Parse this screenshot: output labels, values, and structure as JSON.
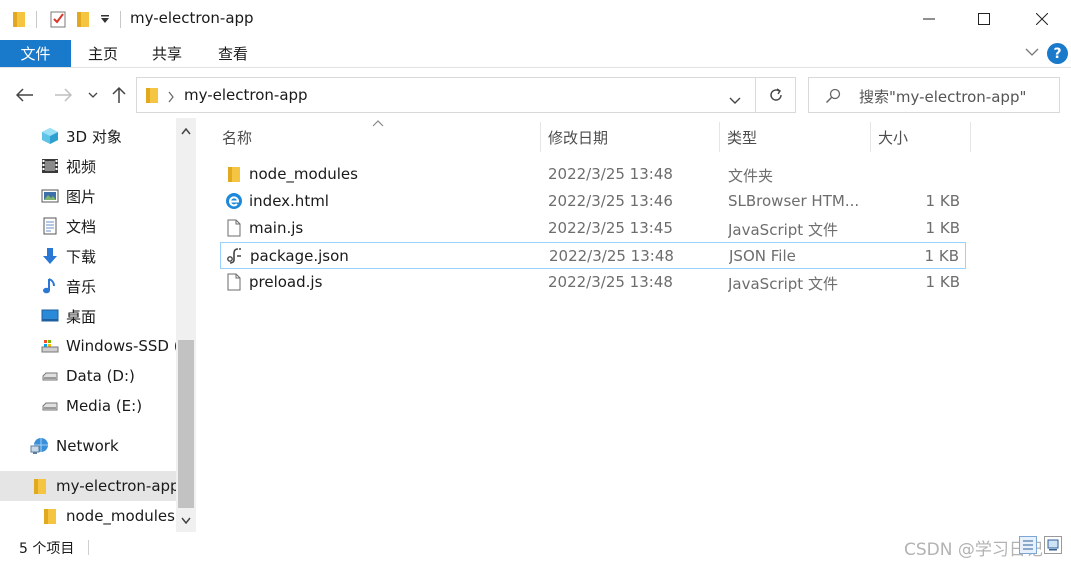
{
  "window": {
    "title": "my-electron-app",
    "minimize_glyph": "—",
    "maximize_glyph": "☐",
    "close_glyph": "✕"
  },
  "ribbon": {
    "tabs": [
      {
        "label": "文件",
        "active": true
      },
      {
        "label": "主页"
      },
      {
        "label": "共享"
      },
      {
        "label": "查看"
      }
    ],
    "help_glyph": "?"
  },
  "address": {
    "path_segment": "my-electron-app",
    "search_placeholder": "搜索\"my-electron-app\""
  },
  "sidebar": {
    "items": [
      {
        "label": "3D 对象",
        "icon": "3d-objects-icon"
      },
      {
        "label": "视频",
        "icon": "video-icon"
      },
      {
        "label": "图片",
        "icon": "pictures-icon"
      },
      {
        "label": "文档",
        "icon": "documents-icon"
      },
      {
        "label": "下载",
        "icon": "download-icon"
      },
      {
        "label": "音乐",
        "icon": "music-icon"
      },
      {
        "label": "桌面",
        "icon": "desktop-icon"
      },
      {
        "label": "Windows-SSD (",
        "icon": "drive-c-icon"
      },
      {
        "label": "Data (D:)",
        "icon": "drive-icon"
      },
      {
        "label": "Media (E:)",
        "icon": "drive-icon"
      },
      {
        "label": "Network",
        "icon": "network-icon"
      },
      {
        "label": "my-electron-app",
        "icon": "folder-icon",
        "selected": true
      },
      {
        "label": "node_modules",
        "icon": "folder-icon"
      }
    ]
  },
  "columns": {
    "name": "名称",
    "date": "修改日期",
    "type": "类型",
    "size": "大小"
  },
  "files": [
    {
      "name": "node_modules",
      "date": "2022/3/25 13:48",
      "type": "文件夹",
      "size": "",
      "icon": "folder-icon"
    },
    {
      "name": "index.html",
      "date": "2022/3/25 13:46",
      "type": "SLBrowser HTM...",
      "size": "1 KB",
      "icon": "browser-html-icon"
    },
    {
      "name": "main.js",
      "date": "2022/3/25 13:45",
      "type": "JavaScript 文件",
      "size": "1 KB",
      "icon": "file-icon"
    },
    {
      "name": "package.json",
      "date": "2022/3/25 13:48",
      "type": "JSON File",
      "size": "1 KB",
      "icon": "json-file-icon",
      "focused": true
    },
    {
      "name": "preload.js",
      "date": "2022/3/25 13:48",
      "type": "JavaScript 文件",
      "size": "1 KB",
      "icon": "file-icon"
    }
  ],
  "status": {
    "item_count": "5 个项目",
    "watermark": "CSDN @学习日记"
  },
  "colors": {
    "accent": "#1979ca",
    "folder": "#f5c542",
    "selection_border": "#99d1ff"
  }
}
